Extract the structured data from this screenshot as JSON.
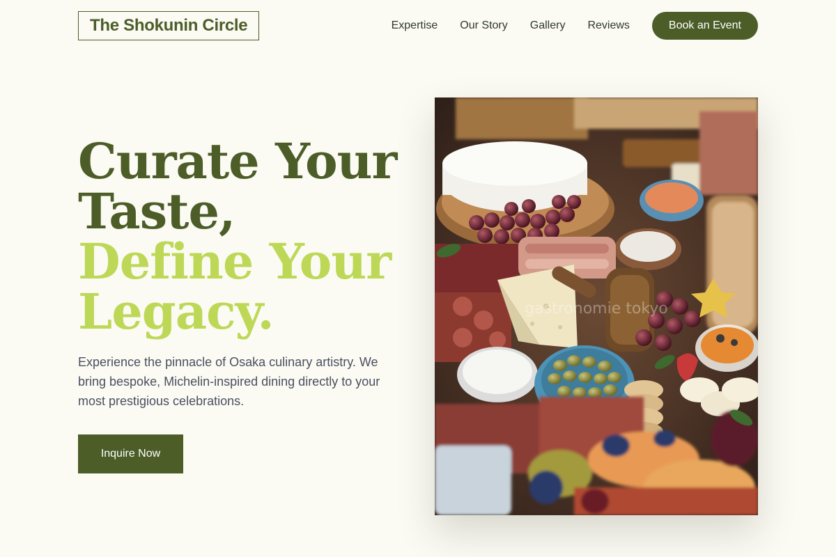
{
  "brand": {
    "name": "The Shokunin Circle"
  },
  "nav": {
    "items": [
      {
        "label": "Expertise"
      },
      {
        "label": "Our Story"
      },
      {
        "label": "Gallery"
      },
      {
        "label": "Reviews"
      }
    ],
    "cta_label": "Book an Event"
  },
  "hero": {
    "headline_line1": "Curate Your",
    "headline_line2": "Taste,",
    "headline_line3": "Define Your",
    "headline_line4": "Legacy.",
    "lead": "Experience the pinnacle of Osaka culinary artistry. We bring bespoke, Michelin-inspired dining directly to your most prestigious celebrations.",
    "button_label": "Inquire Now",
    "image_watermark": "gastronomie tokyo"
  },
  "colors": {
    "brand_green": "#4c5d28",
    "accent_lime": "#bcd856",
    "background": "#fbfaf3"
  }
}
